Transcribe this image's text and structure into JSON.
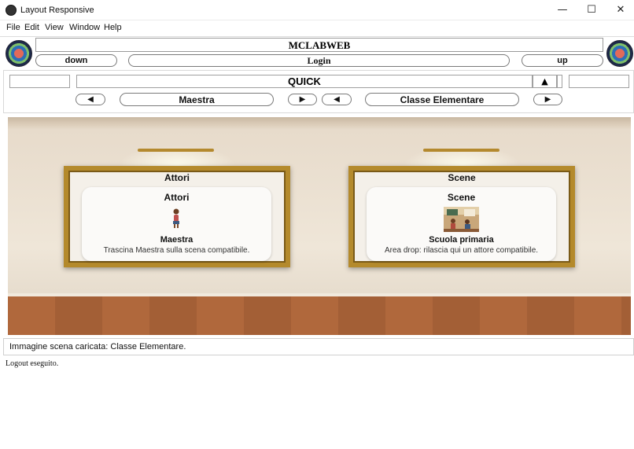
{
  "window": {
    "title": "Layout Responsive",
    "controls": {
      "minimize": "—",
      "maximize": "☐",
      "close": "✕"
    }
  },
  "menu": [
    "File",
    "Edit",
    "View",
    "Window",
    "Help"
  ],
  "header": {
    "app_name": "MCLABWEB",
    "down_label": "down",
    "login_label": "Login",
    "up_label": "up"
  },
  "quick": {
    "label": "QUICK",
    "toggle": "▲",
    "role_prev": "◀",
    "role_value": "Maestra",
    "role_next": "▶",
    "scene_prev": "◀",
    "scene_value": "Classe Elementare",
    "scene_next": "▶"
  },
  "panels": {
    "actors": {
      "frame_title": "Attori",
      "card_title": "Attori",
      "item_name": "Maestra",
      "item_desc": "Trascina Maestra sulla scena compatibile."
    },
    "scenes": {
      "frame_title": "Scene",
      "card_title": "Scene",
      "item_name": "Scuola primaria",
      "item_desc": "Area drop: rilascia qui un attore compatibile."
    }
  },
  "status": "Immagine scena caricata: Classe Elementare.",
  "log": "Logout eseguito.",
  "colors": {
    "frame_gold": "#b48a2c",
    "wall": "#efe6d8",
    "floor": "#a86a42"
  }
}
